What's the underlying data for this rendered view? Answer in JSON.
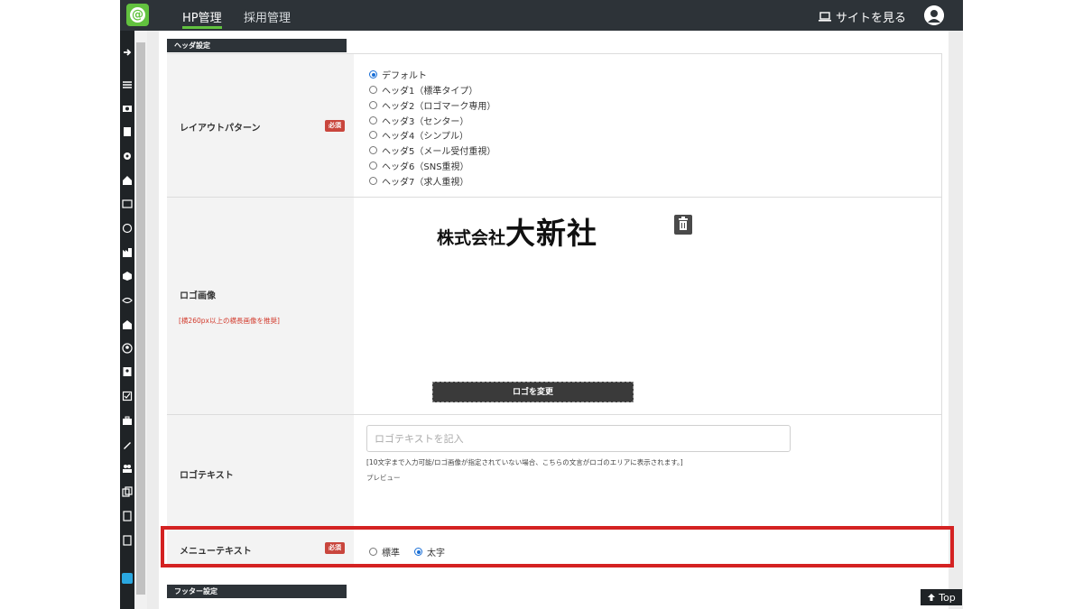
{
  "topbar": {
    "tabs": [
      {
        "label": "HP管理",
        "active": true
      },
      {
        "label": "採用管理",
        "active": false
      }
    ],
    "view_site_label": "サイトを見る"
  },
  "sections": {
    "header_settings": "ヘッダ設定",
    "footer_settings": "フッター設定"
  },
  "layout_pattern": {
    "label": "レイアウトパターン",
    "required_badge": "必須",
    "options": [
      {
        "label": "デフォルト",
        "selected": true
      },
      {
        "label": "ヘッダ1（標準タイプ）",
        "selected": false
      },
      {
        "label": "ヘッダ2（ロゴマーク専用）",
        "selected": false
      },
      {
        "label": "ヘッダ3（センター）",
        "selected": false
      },
      {
        "label": "ヘッダ4（シンプル）",
        "selected": false
      },
      {
        "label": "ヘッダ5（メール受付重視）",
        "selected": false
      },
      {
        "label": "ヘッダ6（SNS重視）",
        "selected": false
      },
      {
        "label": "ヘッダ7（求人重視）",
        "selected": false
      }
    ]
  },
  "logo_image": {
    "label": "ロゴ画像",
    "recommend_note": "[横260px以上の横長画像を推奨]",
    "logo_text_small": "株式会社",
    "logo_text_big": "大新社",
    "change_button": "ロゴを変更"
  },
  "logo_text": {
    "label": "ロゴテキスト",
    "placeholder": "ロゴテキストを記入",
    "value": "",
    "note": "[10文字まで入力可能/ロゴ画像が指定されていない場合、こちらの文言がロゴのエリアに表示されます。]",
    "preview_label": "プレビュー"
  },
  "menu_text": {
    "label": "メニューテキスト",
    "required_badge": "必須",
    "options": [
      {
        "label": "標準",
        "selected": false
      },
      {
        "label": "太字",
        "selected": true
      }
    ]
  },
  "top_button": "Top",
  "colors": {
    "topbar": "#2d3338",
    "accent_green": "#62c23f",
    "required_red": "#c9463d",
    "highlight_red": "#d42222",
    "radio_blue": "#1a6fd6"
  }
}
